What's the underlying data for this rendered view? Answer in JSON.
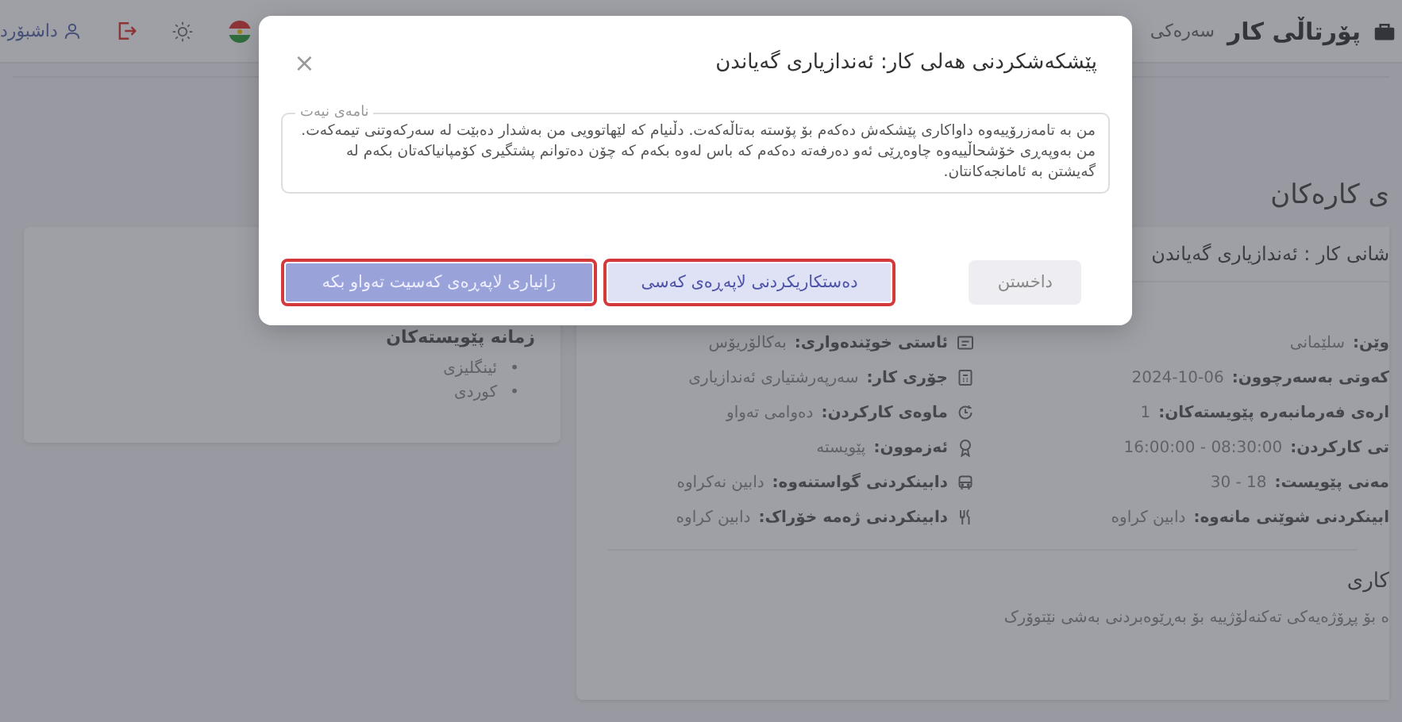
{
  "topbar": {
    "brand": "پۆرتاڵی کار",
    "nav": [
      {
        "label": "سەرەکی"
      }
    ],
    "user_link": "داشبۆرد"
  },
  "page_title": "ی کارەکان",
  "job_card": {
    "title": "شانی کار : ئەندازیاری گەیاندن",
    "details_right": [
      {
        "label": "وێن:",
        "value": "سلێمانی"
      },
      {
        "label": "کەوتی بەسەرچوون:",
        "value": "2024-10-06"
      },
      {
        "label": "ارەی فەرمانبەرە پێویستەکان:",
        "value": "1"
      },
      {
        "label": "تی کارکردن:",
        "value": "08:30:00 - 16:00:00"
      },
      {
        "label": "مەنی پێویست:",
        "value": "18 - 30"
      },
      {
        "label": "ابینکردنی شوێنی مانەوە:",
        "value": "دابین کراوە"
      }
    ],
    "details_left": [
      {
        "label": "ئاستی خوێندەواری:",
        "value": "بەکالۆریۆس"
      },
      {
        "label": "جۆری کار:",
        "value": "سەرپەرشتیاری ئەندازیاری"
      },
      {
        "label": "ماوەی کارکردن:",
        "value": "دەوامی تەواو"
      },
      {
        "label": "ئەزموون:",
        "value": "پێویستە"
      },
      {
        "label": "دابینکردنی گواستنەوە:",
        "value": "دابین نەکراوە"
      },
      {
        "label": "دابینکردنی ژەمە خۆراک:",
        "value": "دابین کراوە"
      }
    ],
    "section_heading": "کاری",
    "description": "ە بۆ پڕۆژەیەکی تەکنەلۆژییە بۆ بەڕێوەبردنی بەشی نێتوۆرک"
  },
  "languages_card": {
    "heading": "زمانە پێویستەکان",
    "items": [
      {
        "marker": "•",
        "label": "ئینگلیزی"
      },
      {
        "marker": "•",
        "label": "کوردی"
      }
    ]
  },
  "modal": {
    "title": "پێشکەشکردنی هەلی کار: ئەندازیاری گەیاندن",
    "close": "×",
    "letter": {
      "legend": "نامەی نیەت",
      "value": "من بە تامەزرۆییەوە داواکاری پێشکەش دەکەم بۆ پۆستە بەتاڵەکەت. دڵنیام کە لێهاتوویی من بەشدار دەبێت لە سەرکەوتنی تیمەکەت. من بەوپەڕی خۆشحاڵییەوە چاوەڕێی ئەو دەرفەتە دەکەم کە باس لەوە بکەم کە چۆن دەتوانم پشتگیری کۆمپانیاکەتان بکەم لە گەیشتن بە ئامانجەکانتان."
    },
    "buttons": [
      {
        "label": "داخستن",
        "kind": "secondary",
        "highlighted": false
      },
      {
        "label": "دەستکاریکردنی لاپەڕەی کەسی",
        "kind": "light",
        "highlighted": true
      },
      {
        "label": "زانیاری لاپەڕەی کەسیت تەواو بکە",
        "kind": "primary",
        "highlighted": true
      }
    ]
  }
}
